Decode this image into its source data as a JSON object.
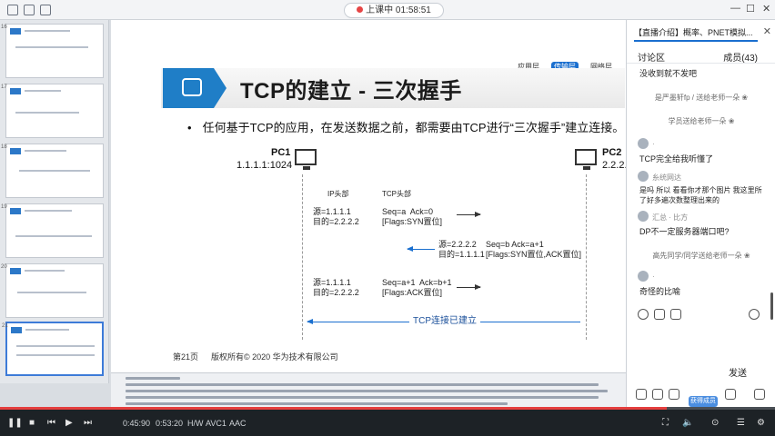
{
  "top": {
    "live_status": "上课中 01:58:51",
    "window_controls": [
      "minimize-icon",
      "maximize-icon",
      "close-icon"
    ]
  },
  "thumbs": [
    {
      "num": "16"
    },
    {
      "num": "17"
    },
    {
      "num": "18"
    },
    {
      "num": "19"
    },
    {
      "num": "20"
    },
    {
      "num": "21"
    }
  ],
  "slide": {
    "title": "TCP的建立 - 三次握手",
    "nav_tabs": [
      "应用层",
      "传输层",
      "网络层"
    ],
    "active_tab_index": 1,
    "bullet": "任何基于TCP的应用，在发送数据之前，都需要由TCP进行“三次握手”建立连接。",
    "pc1_label": "PC1",
    "pc1_addr": "1.1.1.1:1024",
    "pc2_label": "PC2",
    "pc2_addr": "2.2.2.",
    "ip_header": "IP头部",
    "tcp_header": "TCP头部",
    "seg1_ip": "源=1.1.1.1\n目的=2.2.2.2",
    "seg1_tcp": "Seq=a  Ack=0\n[Flags:SYN置位]",
    "seg2_ip": "源=2.2.2.2\n目的=1.1.1.1",
    "seg2_tcp": "Seq=b Ack=a+1\n[Flags:SYN置位,ACK置位]",
    "seg3_ip": "源=1.1.1.1\n目的=2.2.2.2",
    "seg3_tcp": "Seq=a+1  Ack=b+1\n[Flags:ACK置位]",
    "established": "TCP连接已建立",
    "page": "第21页",
    "copyright": "版权所有© 2020 华为技术有限公司"
  },
  "panel": {
    "tab": "【直播介绍】概率、PNET模拟...",
    "section": "讨论区",
    "members": "成员(43)",
    "messages": [
      {
        "type": "msg",
        "text": "没收到就不发吧"
      },
      {
        "type": "sys",
        "text": "是严墨轩fp / 送给老师一朵 ❀"
      },
      {
        "type": "sys",
        "text": "学员送给老师一朵 ❀"
      },
      {
        "type": "name",
        "text": "·"
      },
      {
        "type": "msg",
        "text": "TCP完全给我听懂了"
      },
      {
        "type": "name",
        "text": "糸统网达"
      },
      {
        "type": "msg",
        "text": "是吗 所以 看看你才那个图片 我这里所"
      },
      {
        "type": "msg",
        "text": "了好多遍次数整理出来的"
      },
      {
        "type": "name",
        "text": "汇总 · 比方"
      },
      {
        "type": "msg",
        "text": "DP不一定服务器端口吧?"
      },
      {
        "type": "sys",
        "text": "高先同学/同学送给老师一朵 ❀"
      },
      {
        "type": "name",
        "text": "·"
      },
      {
        "type": "msg",
        "text": "奇怪的比喻"
      }
    ],
    "send": "发送",
    "badge": "获得成员"
  },
  "player": {
    "time_current": "0:45:90",
    "time_total": "0:53:20",
    "label_a": "H/W",
    "label_b": "AVC1",
    "label_c": "AAC",
    "progress": 0.86
  }
}
